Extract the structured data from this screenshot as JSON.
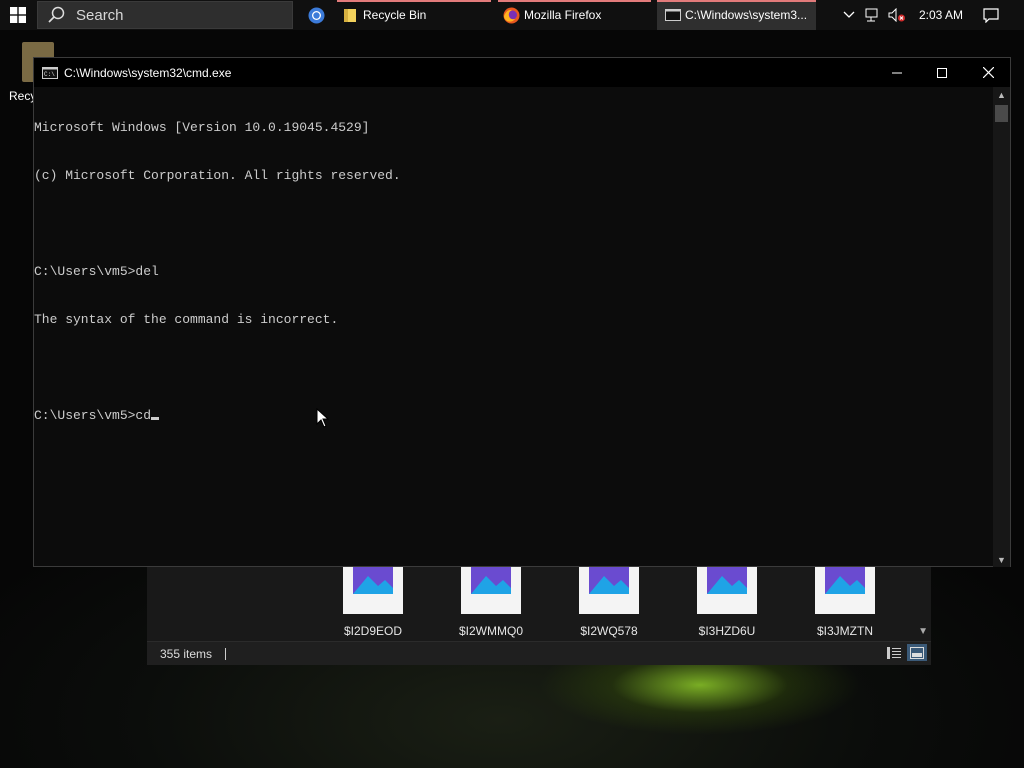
{
  "taskbar": {
    "search_placeholder": "Search",
    "apps": [
      {
        "label": "Recycle Bin",
        "icon": "folder-icon"
      },
      {
        "label": "Mozilla Firefox",
        "icon": "firefox-icon"
      },
      {
        "label": "C:\\Windows\\system3...",
        "icon": "cmd-icon",
        "active": true
      }
    ],
    "clock": "2:03 AM"
  },
  "desktop": {
    "recycle_label": "Recy"
  },
  "cmd_window": {
    "title": "C:\\Windows\\system32\\cmd.exe",
    "lines": [
      "Microsoft Windows [Version 10.0.19045.4529]",
      "(c) Microsoft Corporation. All rights reserved.",
      "",
      "C:\\Users\\vm5>del",
      "The syntax of the command is incorrect.",
      "",
      "C:\\Users\\vm5>cd"
    ]
  },
  "explorer": {
    "files": [
      {
        "name": "$I2D9EOD"
      },
      {
        "name": "$I2WMMQ0"
      },
      {
        "name": "$I2WQ578"
      },
      {
        "name": "$I3HZD6U"
      },
      {
        "name": "$I3JMZTN"
      }
    ],
    "status_items": "355 items"
  },
  "colors": {
    "console_bg": "#0c0c0c",
    "console_text": "#cccccc",
    "taskbar_bg": "#101010",
    "active_indicator": "#e27b7b"
  }
}
